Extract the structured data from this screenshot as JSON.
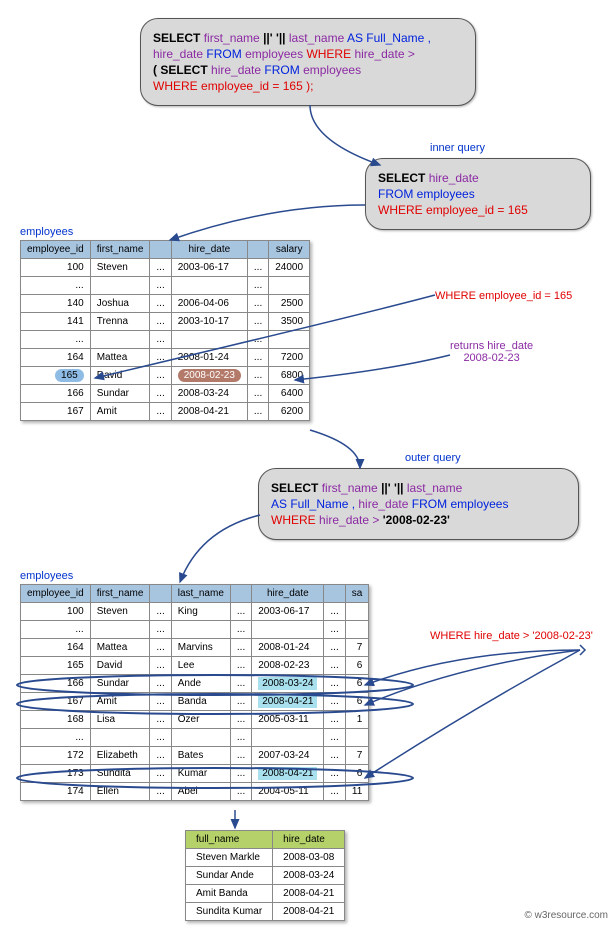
{
  "main_query": {
    "l1_a": "SELECT",
    "l1_b": "first_name",
    "l1_c": "||' '||",
    "l1_d": "last_name",
    "l1_e": "AS Full_Name ,",
    "l2_a": "hire_date",
    "l2_b": "FROM",
    "l2_c": "employees",
    "l2_d": "WHERE",
    "l2_e": "hire_date >",
    "l3_a": "( SELECT",
    "l3_b": "hire_date",
    "l3_c": "FROM",
    "l3_d": "employees",
    "l4_a": "WHERE",
    "l4_b": "employee_id = 165 );"
  },
  "inner_query": {
    "label": "inner query",
    "l1_a": "SELECT",
    "l1_b": "hire_date",
    "l2_a": "FROM",
    "l2_b": "employees",
    "l3_a": "WHERE",
    "l3_b": "employee_id = 165"
  },
  "outer_query": {
    "label": "outer query",
    "l1_a": "SELECT",
    "l1_b": "first_name",
    "l1_c": "||' '||",
    "l1_d": "last_name",
    "l2_a": "AS Full_Name ,",
    "l2_b": "hire_date",
    "l2_c": "FROM",
    "l2_d": "employees",
    "l3_a": "WHERE",
    "l3_b": "hire_date >",
    "l3_c": "'2008-02-23'"
  },
  "annotations": {
    "where_emp": "WHERE employee_id = 165",
    "returns_hire": "returns hire_date",
    "returns_date": "2008-02-23",
    "where_hire": "WHERE hire_date > '2008-02-23'"
  },
  "table1": {
    "title": "employees",
    "headers": [
      "employee_id",
      "first_name",
      "",
      "hire_date",
      "",
      "salary"
    ],
    "rows": [
      [
        "100",
        "Steven",
        "...",
        "2003-06-17",
        "...",
        "24000"
      ],
      [
        "...",
        "",
        "...",
        "",
        "...",
        ""
      ],
      [
        "140",
        "Joshua",
        "...",
        "2006-04-06",
        "...",
        "2500"
      ],
      [
        "141",
        "Trenna",
        "...",
        "2003-10-17",
        "...",
        "3500"
      ],
      [
        "...",
        "",
        "...",
        "",
        "...",
        ""
      ],
      [
        "164",
        "Mattea",
        "...",
        "2008-01-24",
        "...",
        "7200"
      ],
      [
        "165",
        "David",
        "...",
        "2008-02-23",
        "...",
        "6800"
      ],
      [
        "166",
        "Sundar",
        "...",
        "2008-03-24",
        "...",
        "6400"
      ],
      [
        "167",
        "Amit",
        "...",
        "2008-04-21",
        "...",
        "6200"
      ]
    ]
  },
  "table2": {
    "title": "employees",
    "headers": [
      "employee_id",
      "first_name",
      "",
      "last_name",
      "",
      "hire_date",
      "",
      "sa"
    ],
    "rows": [
      [
        "100",
        "Steven",
        "...",
        "King",
        "...",
        "2003-06-17",
        "...",
        ""
      ],
      [
        "...",
        "",
        "...",
        "",
        "...",
        "",
        "...",
        ""
      ],
      [
        "164",
        "Mattea",
        "...",
        "Marvins",
        "...",
        "2008-01-24",
        "...",
        "7"
      ],
      [
        "165",
        "David",
        "...",
        "Lee",
        "...",
        "2008-02-23",
        "...",
        "6"
      ],
      [
        "166",
        "Sundar",
        "...",
        "Ande",
        "...",
        "2008-03-24",
        "...",
        "6"
      ],
      [
        "167",
        "Amit",
        "...",
        "Banda",
        "...",
        "2008-04-21",
        "...",
        "6"
      ],
      [
        "168",
        "Lisa",
        "...",
        "Ozer",
        "...",
        "2005-03-11",
        "...",
        "1"
      ],
      [
        "...",
        "",
        "...",
        "",
        "...",
        "",
        "...",
        ""
      ],
      [
        "172",
        "Elizabeth",
        "...",
        "Bates",
        "...",
        "2007-03-24",
        "...",
        "7"
      ],
      [
        "173",
        "Sundita",
        "...",
        "Kumar",
        "...",
        "2008-04-21",
        "...",
        "6"
      ],
      [
        "174",
        "Ellen",
        "...",
        "Abel",
        "...",
        "2004-05-11",
        "...",
        "11"
      ]
    ]
  },
  "result": {
    "headers": [
      "full_name",
      "hire_date"
    ],
    "rows": [
      [
        "Steven Markle",
        "2008-03-08"
      ],
      [
        "Sundar Ande",
        "2008-03-24"
      ],
      [
        "Amit Banda",
        "2008-04-21"
      ],
      [
        "Sundita Kumar",
        "2008-04-21"
      ]
    ]
  },
  "footer": "© w3resource.com",
  "chart_data": {
    "type": "table",
    "description": "SQL subquery explanation diagram showing inner query selecting hire_date for employee_id=165 (returns 2008-02-23), then outer query selecting employees hired after that date.",
    "inner_query_result": "2008-02-23",
    "outer_query_filter": "hire_date > 2008-02-23",
    "employees_sample": [
      {
        "employee_id": 100,
        "first_name": "Steven",
        "last_name": "King",
        "hire_date": "2003-06-17",
        "salary": 24000
      },
      {
        "employee_id": 140,
        "first_name": "Joshua",
        "hire_date": "2006-04-06",
        "salary": 2500
      },
      {
        "employee_id": 141,
        "first_name": "Trenna",
        "hire_date": "2003-10-17",
        "salary": 3500
      },
      {
        "employee_id": 164,
        "first_name": "Mattea",
        "last_name": "Marvins",
        "hire_date": "2008-01-24",
        "salary": 7200
      },
      {
        "employee_id": 165,
        "first_name": "David",
        "last_name": "Lee",
        "hire_date": "2008-02-23",
        "salary": 6800
      },
      {
        "employee_id": 166,
        "first_name": "Sundar",
        "last_name": "Ande",
        "hire_date": "2008-03-24",
        "salary": 6400
      },
      {
        "employee_id": 167,
        "first_name": "Amit",
        "last_name": "Banda",
        "hire_date": "2008-04-21",
        "salary": 6200
      },
      {
        "employee_id": 168,
        "first_name": "Lisa",
        "last_name": "Ozer",
        "hire_date": "2005-03-11"
      },
      {
        "employee_id": 172,
        "first_name": "Elizabeth",
        "last_name": "Bates",
        "hire_date": "2007-03-24"
      },
      {
        "employee_id": 173,
        "first_name": "Sundita",
        "last_name": "Kumar",
        "hire_date": "2008-04-21"
      },
      {
        "employee_id": 174,
        "first_name": "Ellen",
        "last_name": "Abel",
        "hire_date": "2004-05-11"
      }
    ],
    "final_result": [
      {
        "full_name": "Steven Markle",
        "hire_date": "2008-03-08"
      },
      {
        "full_name": "Sundar Ande",
        "hire_date": "2008-03-24"
      },
      {
        "full_name": "Amit Banda",
        "hire_date": "2008-04-21"
      },
      {
        "full_name": "Sundita Kumar",
        "hire_date": "2008-04-21"
      }
    ]
  }
}
